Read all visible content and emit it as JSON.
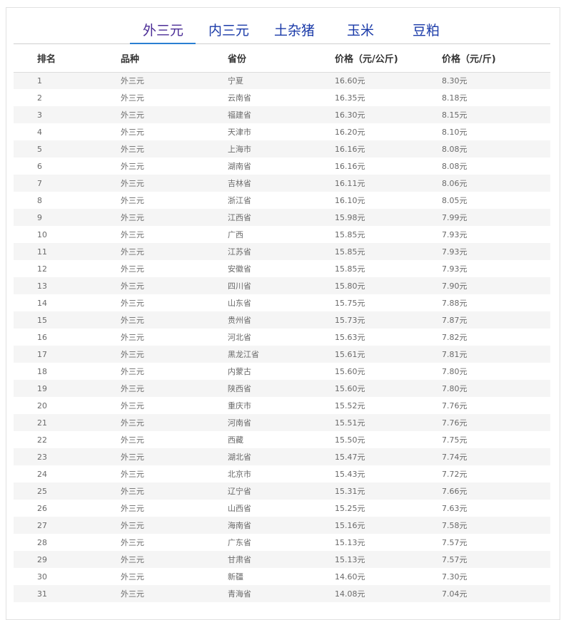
{
  "tabs": [
    {
      "label": "外三元",
      "active": true
    },
    {
      "label": "内三元",
      "active": false
    },
    {
      "label": "土杂猪",
      "active": false
    },
    {
      "label": "玉米",
      "active": false
    },
    {
      "label": "豆粕",
      "active": false
    }
  ],
  "table": {
    "headers": [
      "排名",
      "品种",
      "省份",
      "价格（元/公斤)",
      "价格（元/斤)"
    ],
    "rows": [
      [
        "1",
        "外三元",
        "宁夏",
        "16.60元",
        "8.30元"
      ],
      [
        "2",
        "外三元",
        "云南省",
        "16.35元",
        "8.18元"
      ],
      [
        "3",
        "外三元",
        "福建省",
        "16.30元",
        "8.15元"
      ],
      [
        "4",
        "外三元",
        "天津市",
        "16.20元",
        "8.10元"
      ],
      [
        "5",
        "外三元",
        "上海市",
        "16.16元",
        "8.08元"
      ],
      [
        "6",
        "外三元",
        "湖南省",
        "16.16元",
        "8.08元"
      ],
      [
        "7",
        "外三元",
        "吉林省",
        "16.11元",
        "8.06元"
      ],
      [
        "8",
        "外三元",
        "浙江省",
        "16.10元",
        "8.05元"
      ],
      [
        "9",
        "外三元",
        "江西省",
        "15.98元",
        "7.99元"
      ],
      [
        "10",
        "外三元",
        "广西",
        "15.85元",
        "7.93元"
      ],
      [
        "11",
        "外三元",
        "江苏省",
        "15.85元",
        "7.93元"
      ],
      [
        "12",
        "外三元",
        "安徽省",
        "15.85元",
        "7.93元"
      ],
      [
        "13",
        "外三元",
        "四川省",
        "15.80元",
        "7.90元"
      ],
      [
        "14",
        "外三元",
        "山东省",
        "15.75元",
        "7.88元"
      ],
      [
        "15",
        "外三元",
        "贵州省",
        "15.73元",
        "7.87元"
      ],
      [
        "16",
        "外三元",
        "河北省",
        "15.63元",
        "7.82元"
      ],
      [
        "17",
        "外三元",
        "黑龙江省",
        "15.61元",
        "7.81元"
      ],
      [
        "18",
        "外三元",
        "内蒙古",
        "15.60元",
        "7.80元"
      ],
      [
        "19",
        "外三元",
        "陕西省",
        "15.60元",
        "7.80元"
      ],
      [
        "20",
        "外三元",
        "重庆市",
        "15.52元",
        "7.76元"
      ],
      [
        "21",
        "外三元",
        "河南省",
        "15.51元",
        "7.76元"
      ],
      [
        "22",
        "外三元",
        "西藏",
        "15.50元",
        "7.75元"
      ],
      [
        "23",
        "外三元",
        "湖北省",
        "15.47元",
        "7.74元"
      ],
      [
        "24",
        "外三元",
        "北京市",
        "15.43元",
        "7.72元"
      ],
      [
        "25",
        "外三元",
        "辽宁省",
        "15.31元",
        "7.66元"
      ],
      [
        "26",
        "外三元",
        "山西省",
        "15.25元",
        "7.63元"
      ],
      [
        "27",
        "外三元",
        "海南省",
        "15.16元",
        "7.58元"
      ],
      [
        "28",
        "外三元",
        "广东省",
        "15.13元",
        "7.57元"
      ],
      [
        "29",
        "外三元",
        "甘肃省",
        "15.13元",
        "7.57元"
      ],
      [
        "30",
        "外三元",
        "新疆",
        "14.60元",
        "7.30元"
      ],
      [
        "31",
        "外三元",
        "青海省",
        "14.08元",
        "7.04元"
      ]
    ]
  }
}
